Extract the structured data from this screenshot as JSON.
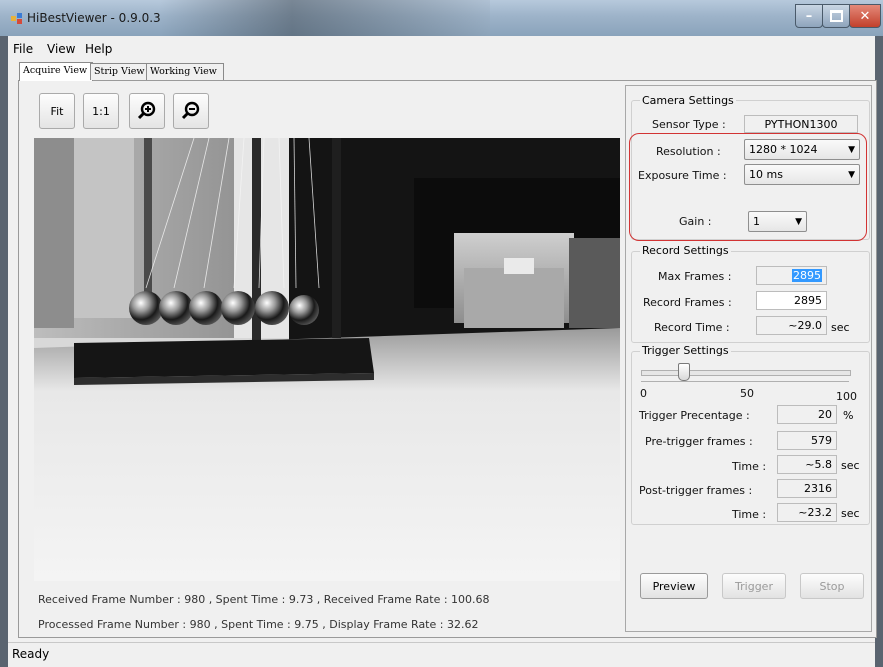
{
  "window": {
    "title": "HiBestViewer - 0.9.0.3"
  },
  "menu": {
    "file": "File",
    "view": "View",
    "help": "Help"
  },
  "tabs": {
    "acquire": "Acquire View",
    "strip": "Strip View",
    "working": "Working View"
  },
  "toolbar": {
    "fit": "Fit",
    "one_to_one": "1:1",
    "zoom_in_icon": "zoom-in-icon",
    "zoom_out_icon": "zoom-out-icon"
  },
  "stats": {
    "received": "Received Frame Number : 980 , Spent Time : 9.73 , Received Frame Rate : 100.68",
    "processed": "Processed Frame Number : 980 , Spent Time : 9.75 ,  Display Frame Rate : 32.62"
  },
  "camera_settings": {
    "title": "Camera Settings",
    "sensor_type_label": "Sensor Type :",
    "sensor_type_value": "PYTHON1300",
    "resolution_label": "Resolution :",
    "resolution_value": "1280 * 1024",
    "exposure_label": "Exposure Time :",
    "exposure_value": "10 ms",
    "gain_label": "Gain :",
    "gain_value": "1"
  },
  "record_settings": {
    "title": "Record Settings",
    "max_frames_label": "Max Frames :",
    "max_frames_value": "2895",
    "record_frames_label": "Record Frames :",
    "record_frames_value": "2895",
    "record_time_label": "Record Time :",
    "record_time_value": "~29.0",
    "record_time_unit": "sec"
  },
  "trigger_settings": {
    "title": "Trigger Settings",
    "slider_value_percent": 20,
    "tick_0": "0",
    "tick_50": "50",
    "tick_100": "100",
    "percentage_label": "Trigger Precentage :",
    "percentage_value": "20",
    "percentage_unit": "%",
    "pre_label": "Pre-trigger frames :",
    "pre_value": "579",
    "pre_time_label": "Time :",
    "pre_time_value": "~5.8",
    "pre_time_unit": "sec",
    "post_label": "Post-trigger frames :",
    "post_value": "2316",
    "post_time_label": "Time :",
    "post_time_value": "~23.2",
    "post_time_unit": "sec"
  },
  "actions": {
    "preview": "Preview",
    "trigger": "Trigger",
    "stop": "Stop"
  },
  "statusbar": {
    "text": "Ready"
  },
  "colors": {
    "highlight": "#d23333",
    "selected_text_bg": "#3399ff"
  }
}
